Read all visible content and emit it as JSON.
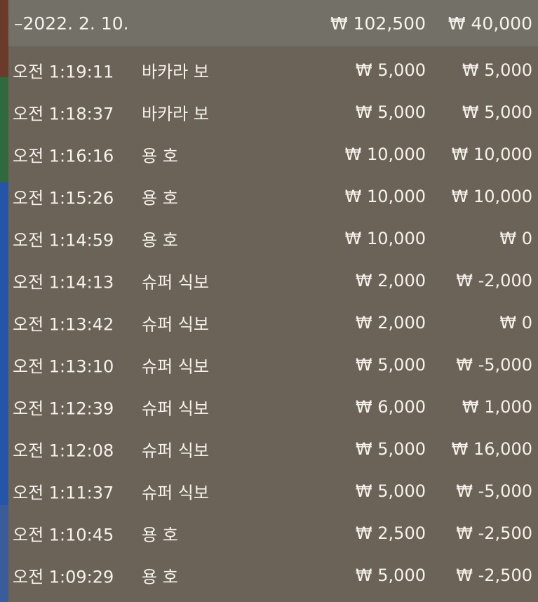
{
  "header": {
    "date": "–2022. 2. 10.",
    "total_bet": "₩ 102,500",
    "total_win": "₩ 40,000"
  },
  "rows": [
    {
      "time": "오전 1:19:11",
      "game": "바카라 보",
      "bet": "₩ 5,000",
      "win": "₩ 5,000"
    },
    {
      "time": "오전 1:18:37",
      "game": "바카라 보",
      "bet": "₩ 5,000",
      "win": "₩ 5,000"
    },
    {
      "time": "오전 1:16:16",
      "game": "용 호",
      "bet": "₩ 10,000",
      "win": "₩ 10,000"
    },
    {
      "time": "오전 1:15:26",
      "game": "용 호",
      "bet": "₩ 10,000",
      "win": "₩ 10,000"
    },
    {
      "time": "오전 1:14:59",
      "game": "용 호",
      "bet": "₩ 10,000",
      "win": "₩ 0"
    },
    {
      "time": "오전 1:14:13",
      "game": "슈퍼 식보",
      "bet": "₩ 2,000",
      "win": "₩ -2,000"
    },
    {
      "time": "오전 1:13:42",
      "game": "슈퍼 식보",
      "bet": "₩ 2,000",
      "win": "₩ 0"
    },
    {
      "time": "오전 1:13:10",
      "game": "슈퍼 식보",
      "bet": "₩ 5,000",
      "win": "₩ -5,000"
    },
    {
      "time": "오전 1:12:39",
      "game": "슈퍼 식보",
      "bet": "₩ 6,000",
      "win": "₩ 1,000"
    },
    {
      "time": "오전 1:12:08",
      "game": "슈퍼 식보",
      "bet": "₩ 5,000",
      "win": "₩ 16,000"
    },
    {
      "time": "오전 1:11:37",
      "game": "슈퍼 식보",
      "bet": "₩ 5,000",
      "win": "₩ -5,000"
    },
    {
      "time": "오전 1:10:45",
      "game": "용 호",
      "bet": "₩ 2,500",
      "win": "₩ -2,500"
    },
    {
      "time": "오전 1:09:29",
      "game": "용 호",
      "bet": "₩ 5,000",
      "win": "₩ -2,500"
    }
  ]
}
